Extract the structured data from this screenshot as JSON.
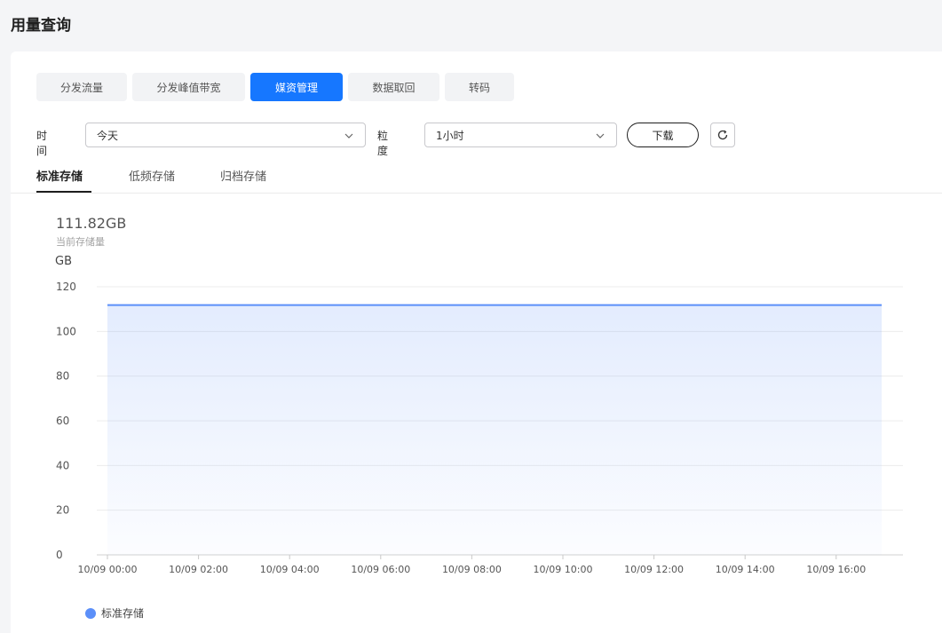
{
  "page": {
    "title": "用量查询"
  },
  "tabs": [
    {
      "label": "分发流量",
      "active": false
    },
    {
      "label": "分发峰值带宽",
      "active": false
    },
    {
      "label": "媒资管理",
      "active": true
    },
    {
      "label": "数据取回",
      "active": false
    },
    {
      "label": "转码",
      "active": false
    }
  ],
  "filters": {
    "time_label": "时间",
    "time_value": "今天",
    "granularity_label": "粒度",
    "granularity_value": "1小时",
    "download_label": "下载"
  },
  "subtabs": [
    {
      "label": "标准存储",
      "active": true
    },
    {
      "label": "低频存储",
      "active": false
    },
    {
      "label": "归档存储",
      "active": false
    }
  ],
  "summary": {
    "value": "111.82GB",
    "label": "当前存储量",
    "unit": "GB"
  },
  "colors": {
    "accent": "#1677ff",
    "series": "#5b8ff9"
  },
  "icons": {
    "time_select": "chevron-down-icon",
    "granularity_select": "chevron-down-icon",
    "refresh": "refresh-icon",
    "legend": "legend-dot"
  },
  "chart_data": {
    "type": "area",
    "ylabel": "GB",
    "ylim": [
      0,
      120
    ],
    "yticks": [
      0,
      20,
      40,
      60,
      80,
      100,
      120
    ],
    "xticks": [
      "10/09 00:00",
      "10/09 02:00",
      "10/09 04:00",
      "10/09 06:00",
      "10/09 08:00",
      "10/09 10:00",
      "10/09 12:00",
      "10/09 14:00",
      "10/09 16:00"
    ],
    "x": [
      "10/09 00:00",
      "10/09 01:00",
      "10/09 02:00",
      "10/09 03:00",
      "10/09 04:00",
      "10/09 05:00",
      "10/09 06:00",
      "10/09 07:00",
      "10/09 08:00",
      "10/09 09:00",
      "10/09 10:00",
      "10/09 11:00",
      "10/09 12:00",
      "10/09 13:00",
      "10/09 14:00",
      "10/09 15:00",
      "10/09 16:00",
      "10/09 17:00"
    ],
    "series": [
      {
        "name": "标准存储",
        "values": [
          111.82,
          111.82,
          111.82,
          111.82,
          111.82,
          111.82,
          111.82,
          111.82,
          111.82,
          111.82,
          111.82,
          111.82,
          111.82,
          111.82,
          111.82,
          111.82,
          111.82,
          111.82
        ]
      }
    ],
    "grid": true,
    "legend": "bottom-left"
  }
}
